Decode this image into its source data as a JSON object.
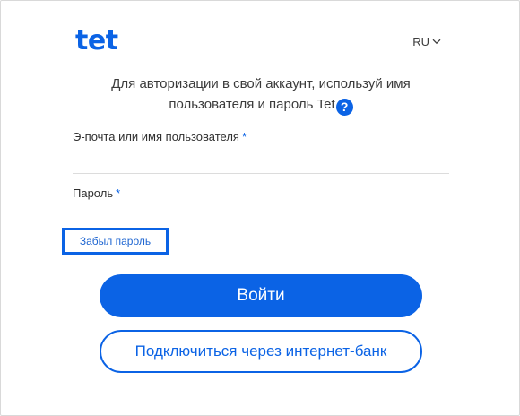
{
  "brand": {
    "logo_text": "tet",
    "accent_color": "#0b63e5"
  },
  "language": {
    "selected": "RU",
    "icon": "chevron-down-icon"
  },
  "intro": {
    "text": "Для авторизации в свой аккаунт, используй имя пользователя и пароль Tet",
    "help_icon_text": "?"
  },
  "form": {
    "username": {
      "label": "Э-почта или имя пользователя",
      "required_mark": "*",
      "value": ""
    },
    "password": {
      "label": "Пароль",
      "required_mark": "*",
      "value": ""
    },
    "forgot_password": "Забыл пароль"
  },
  "actions": {
    "login": "Войти",
    "bank_login": "Подключиться через интернет-банк"
  }
}
